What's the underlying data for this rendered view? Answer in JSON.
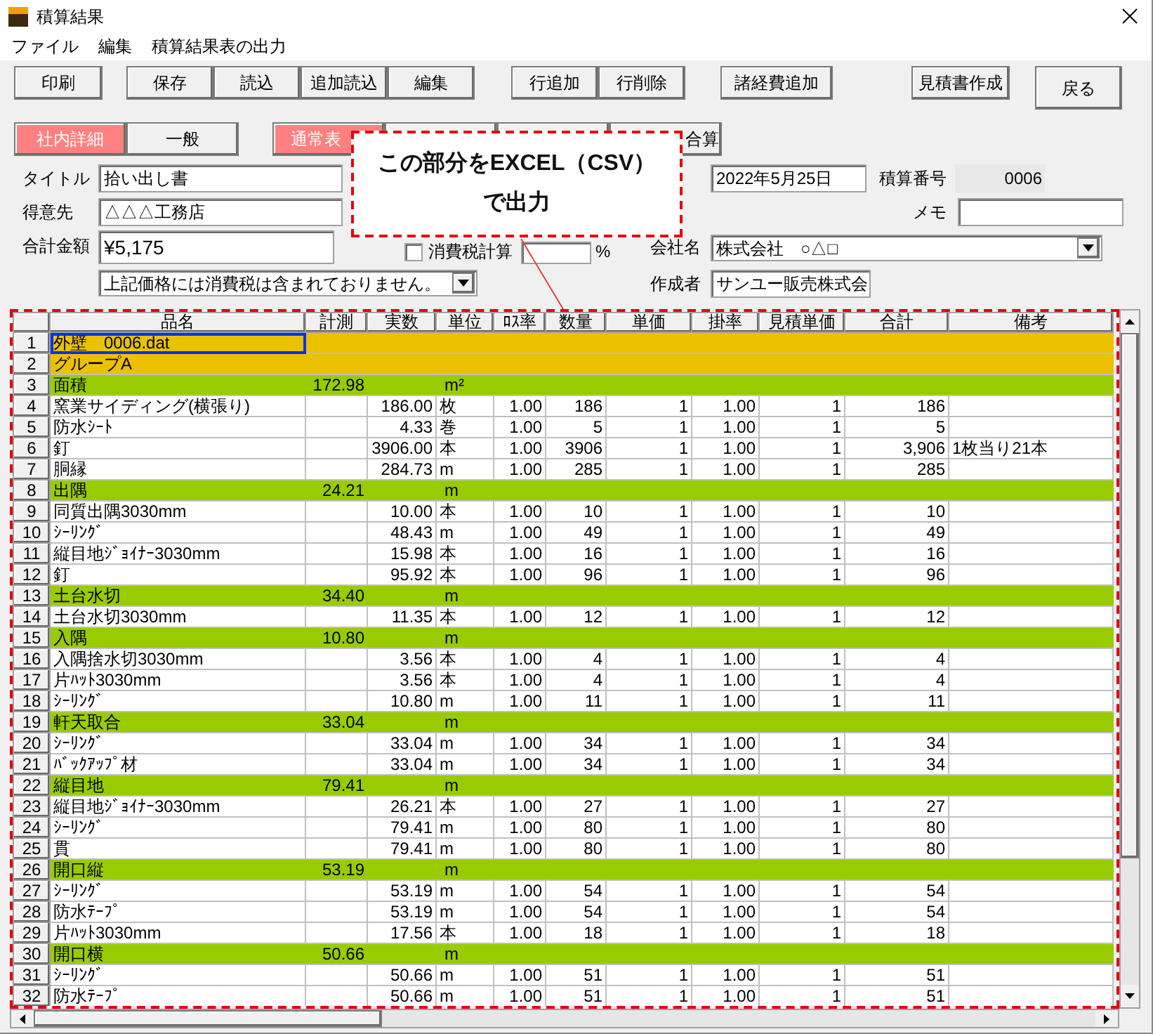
{
  "window": {
    "title": "積算結果"
  },
  "menu": [
    "ファイル",
    "編集",
    "積算結果表の出力"
  ],
  "toolbar": [
    [
      "印刷"
    ],
    [
      "保存",
      "読込",
      "追加読込",
      "編集"
    ],
    [
      "行追加",
      "行削除"
    ],
    [
      "諸経費追加"
    ],
    [
      "見積書作成"
    ],
    [
      "戻る"
    ]
  ],
  "view_tabs": [
    {
      "label": "社内詳細",
      "selected": true
    },
    {
      "label": "一般",
      "selected": false
    }
  ],
  "display_tabs": [
    {
      "label": "通常表",
      "selected": true
    },
    {
      "selected": false
    },
    {
      "selected": false
    },
    {
      "label": "合算",
      "selected": false
    }
  ],
  "callout": {
    "lines": [
      "この部分をEXCEL（CSV）",
      "で出力"
    ]
  },
  "form": {
    "title": {
      "label": "タイトル",
      "value": "拾い出し書"
    },
    "customer": {
      "label": "得意先",
      "value": "△△△工務店"
    },
    "total": {
      "label": "合計金額",
      "value": "¥5,175"
    },
    "tax_note": {
      "value": "上記価格には消費税は含まれておりません。"
    },
    "tax": {
      "label": "消費税計算",
      "checked": false,
      "unit": "%"
    },
    "date": {
      "value": "2022年5月25日"
    },
    "estimate_no": {
      "label": "積算番号",
      "value": "0006"
    },
    "memo": {
      "label": "メモ"
    },
    "company": {
      "label": "会社名",
      "value": "株式会社　○△□"
    },
    "author": {
      "label": "作成者",
      "value": "サンユー販売株式会"
    }
  },
  "table": {
    "columns": [
      "品名",
      "計測",
      "実数",
      "単位",
      "ﾛｽ率",
      "数量",
      "単価",
      "掛率",
      "見積単価",
      "合計",
      "備考"
    ],
    "rows": [
      {
        "no": "1",
        "kind": "title",
        "selected": true,
        "name": "外壁　0006.dat"
      },
      {
        "no": "2",
        "kind": "title",
        "selected": false,
        "name": "グループA"
      },
      {
        "no": "3",
        "kind": "group",
        "selected": false,
        "name": "面積",
        "measure": "172.98",
        "unit": "m²"
      },
      {
        "no": "4",
        "kind": "item",
        "selected": false,
        "name": "窯業サイディング(横張り)",
        "actual": "186.00",
        "unit": "枚",
        "loss": "1.00",
        "qty": "186",
        "price": "1",
        "rate": "1.00",
        "est": "1",
        "total": "186"
      },
      {
        "no": "5",
        "kind": "item",
        "selected": false,
        "name": "防水ｼｰﾄ",
        "actual": "4.33",
        "unit": "巻",
        "loss": "1.00",
        "qty": "5",
        "price": "1",
        "rate": "1.00",
        "est": "1",
        "total": "5"
      },
      {
        "no": "6",
        "kind": "item",
        "selected": false,
        "name": "釘",
        "actual": "3906.00",
        "unit": "本",
        "loss": "1.00",
        "qty": "3906",
        "price": "1",
        "rate": "1.00",
        "est": "1",
        "total": "3,906",
        "note": "1枚当り21本"
      },
      {
        "no": "7",
        "kind": "item",
        "selected": false,
        "name": "胴縁",
        "actual": "284.73",
        "unit": "m",
        "loss": "1.00",
        "qty": "285",
        "price": "1",
        "rate": "1.00",
        "est": "1",
        "total": "285"
      },
      {
        "no": "8",
        "kind": "group",
        "selected": false,
        "name": "出隅",
        "measure": "24.21",
        "unit": "m"
      },
      {
        "no": "9",
        "kind": "item",
        "selected": false,
        "name": "同質出隅3030mm",
        "actual": "10.00",
        "unit": "本",
        "loss": "1.00",
        "qty": "10",
        "price": "1",
        "rate": "1.00",
        "est": "1",
        "total": "10"
      },
      {
        "no": "10",
        "kind": "item",
        "selected": false,
        "name": "ｼｰﾘﾝｸﾞ",
        "actual": "48.43",
        "unit": "m",
        "loss": "1.00",
        "qty": "49",
        "price": "1",
        "rate": "1.00",
        "est": "1",
        "total": "49"
      },
      {
        "no": "11",
        "kind": "item",
        "selected": false,
        "name": "縦目地ｼﾞｮｲﾅｰ3030mm",
        "actual": "15.98",
        "unit": "本",
        "loss": "1.00",
        "qty": "16",
        "price": "1",
        "rate": "1.00",
        "est": "1",
        "total": "16"
      },
      {
        "no": "12",
        "kind": "item",
        "selected": false,
        "name": "釘",
        "actual": "95.92",
        "unit": "本",
        "loss": "1.00",
        "qty": "96",
        "price": "1",
        "rate": "1.00",
        "est": "1",
        "total": "96"
      },
      {
        "no": "13",
        "kind": "group",
        "selected": false,
        "name": "土台水切",
        "measure": "34.40",
        "unit": "m"
      },
      {
        "no": "14",
        "kind": "item",
        "selected": false,
        "name": "土台水切3030mm",
        "actual": "11.35",
        "unit": "本",
        "loss": "1.00",
        "qty": "12",
        "price": "1",
        "rate": "1.00",
        "est": "1",
        "total": "12"
      },
      {
        "no": "15",
        "kind": "group",
        "selected": false,
        "name": "入隅",
        "measure": "10.80",
        "unit": "m"
      },
      {
        "no": "16",
        "kind": "item",
        "selected": false,
        "name": "入隅捨水切3030mm",
        "actual": "3.56",
        "unit": "本",
        "loss": "1.00",
        "qty": "4",
        "price": "1",
        "rate": "1.00",
        "est": "1",
        "total": "4"
      },
      {
        "no": "17",
        "kind": "item",
        "selected": false,
        "name": "片ﾊｯﾄ3030mm",
        "actual": "3.56",
        "unit": "本",
        "loss": "1.00",
        "qty": "4",
        "price": "1",
        "rate": "1.00",
        "est": "1",
        "total": "4"
      },
      {
        "no": "18",
        "kind": "item",
        "selected": false,
        "name": "ｼｰﾘﾝｸﾞ",
        "actual": "10.80",
        "unit": "m",
        "loss": "1.00",
        "qty": "11",
        "price": "1",
        "rate": "1.00",
        "est": "1",
        "total": "11"
      },
      {
        "no": "19",
        "kind": "group",
        "selected": false,
        "name": "軒天取合",
        "measure": "33.04",
        "unit": "m"
      },
      {
        "no": "20",
        "kind": "item",
        "selected": false,
        "name": "ｼｰﾘﾝｸﾞ",
        "actual": "33.04",
        "unit": "m",
        "loss": "1.00",
        "qty": "34",
        "price": "1",
        "rate": "1.00",
        "est": "1",
        "total": "34"
      },
      {
        "no": "21",
        "kind": "item",
        "selected": false,
        "name": "ﾊﾞｯｸｱｯﾌﾟ材",
        "actual": "33.04",
        "unit": "m",
        "loss": "1.00",
        "qty": "34",
        "price": "1",
        "rate": "1.00",
        "est": "1",
        "total": "34"
      },
      {
        "no": "22",
        "kind": "group",
        "selected": false,
        "name": "縦目地",
        "measure": "79.41",
        "unit": "m"
      },
      {
        "no": "23",
        "kind": "item",
        "selected": false,
        "name": "縦目地ｼﾞｮｲﾅｰ3030mm",
        "actual": "26.21",
        "unit": "本",
        "loss": "1.00",
        "qty": "27",
        "price": "1",
        "rate": "1.00",
        "est": "1",
        "total": "27"
      },
      {
        "no": "24",
        "kind": "item",
        "selected": false,
        "name": "ｼｰﾘﾝｸﾞ",
        "actual": "79.41",
        "unit": "m",
        "loss": "1.00",
        "qty": "80",
        "price": "1",
        "rate": "1.00",
        "est": "1",
        "total": "80"
      },
      {
        "no": "25",
        "kind": "item",
        "selected": false,
        "name": "貫",
        "actual": "79.41",
        "unit": "m",
        "loss": "1.00",
        "qty": "80",
        "price": "1",
        "rate": "1.00",
        "est": "1",
        "total": "80"
      },
      {
        "no": "26",
        "kind": "group",
        "selected": false,
        "name": "開口縦",
        "measure": "53.19",
        "unit": "m"
      },
      {
        "no": "27",
        "kind": "item",
        "selected": false,
        "name": "ｼｰﾘﾝｸﾞ",
        "actual": "53.19",
        "unit": "m",
        "loss": "1.00",
        "qty": "54",
        "price": "1",
        "rate": "1.00",
        "est": "1",
        "total": "54"
      },
      {
        "no": "28",
        "kind": "item",
        "selected": false,
        "name": "防水ﾃｰﾌﾟ",
        "actual": "53.19",
        "unit": "m",
        "loss": "1.00",
        "qty": "54",
        "price": "1",
        "rate": "1.00",
        "est": "1",
        "total": "54"
      },
      {
        "no": "29",
        "kind": "item",
        "selected": false,
        "name": "片ﾊｯﾄ3030mm",
        "actual": "17.56",
        "unit": "本",
        "loss": "1.00",
        "qty": "18",
        "price": "1",
        "rate": "1.00",
        "est": "1",
        "total": "18"
      },
      {
        "no": "30",
        "kind": "group",
        "selected": false,
        "name": "開口横",
        "measure": "50.66",
        "unit": "m"
      },
      {
        "no": "31",
        "kind": "item",
        "selected": false,
        "name": "ｼｰﾘﾝｸﾞ",
        "actual": "50.66",
        "unit": "m",
        "loss": "1.00",
        "qty": "51",
        "price": "1",
        "rate": "1.00",
        "est": "1",
        "total": "51"
      },
      {
        "no": "32",
        "kind": "item",
        "selected": false,
        "name": "防水ﾃｰﾌﾟ",
        "actual": "50.66",
        "unit": "m",
        "loss": "1.00",
        "qty": "51",
        "price": "1",
        "rate": "1.00",
        "est": "1",
        "total": "51"
      }
    ]
  }
}
